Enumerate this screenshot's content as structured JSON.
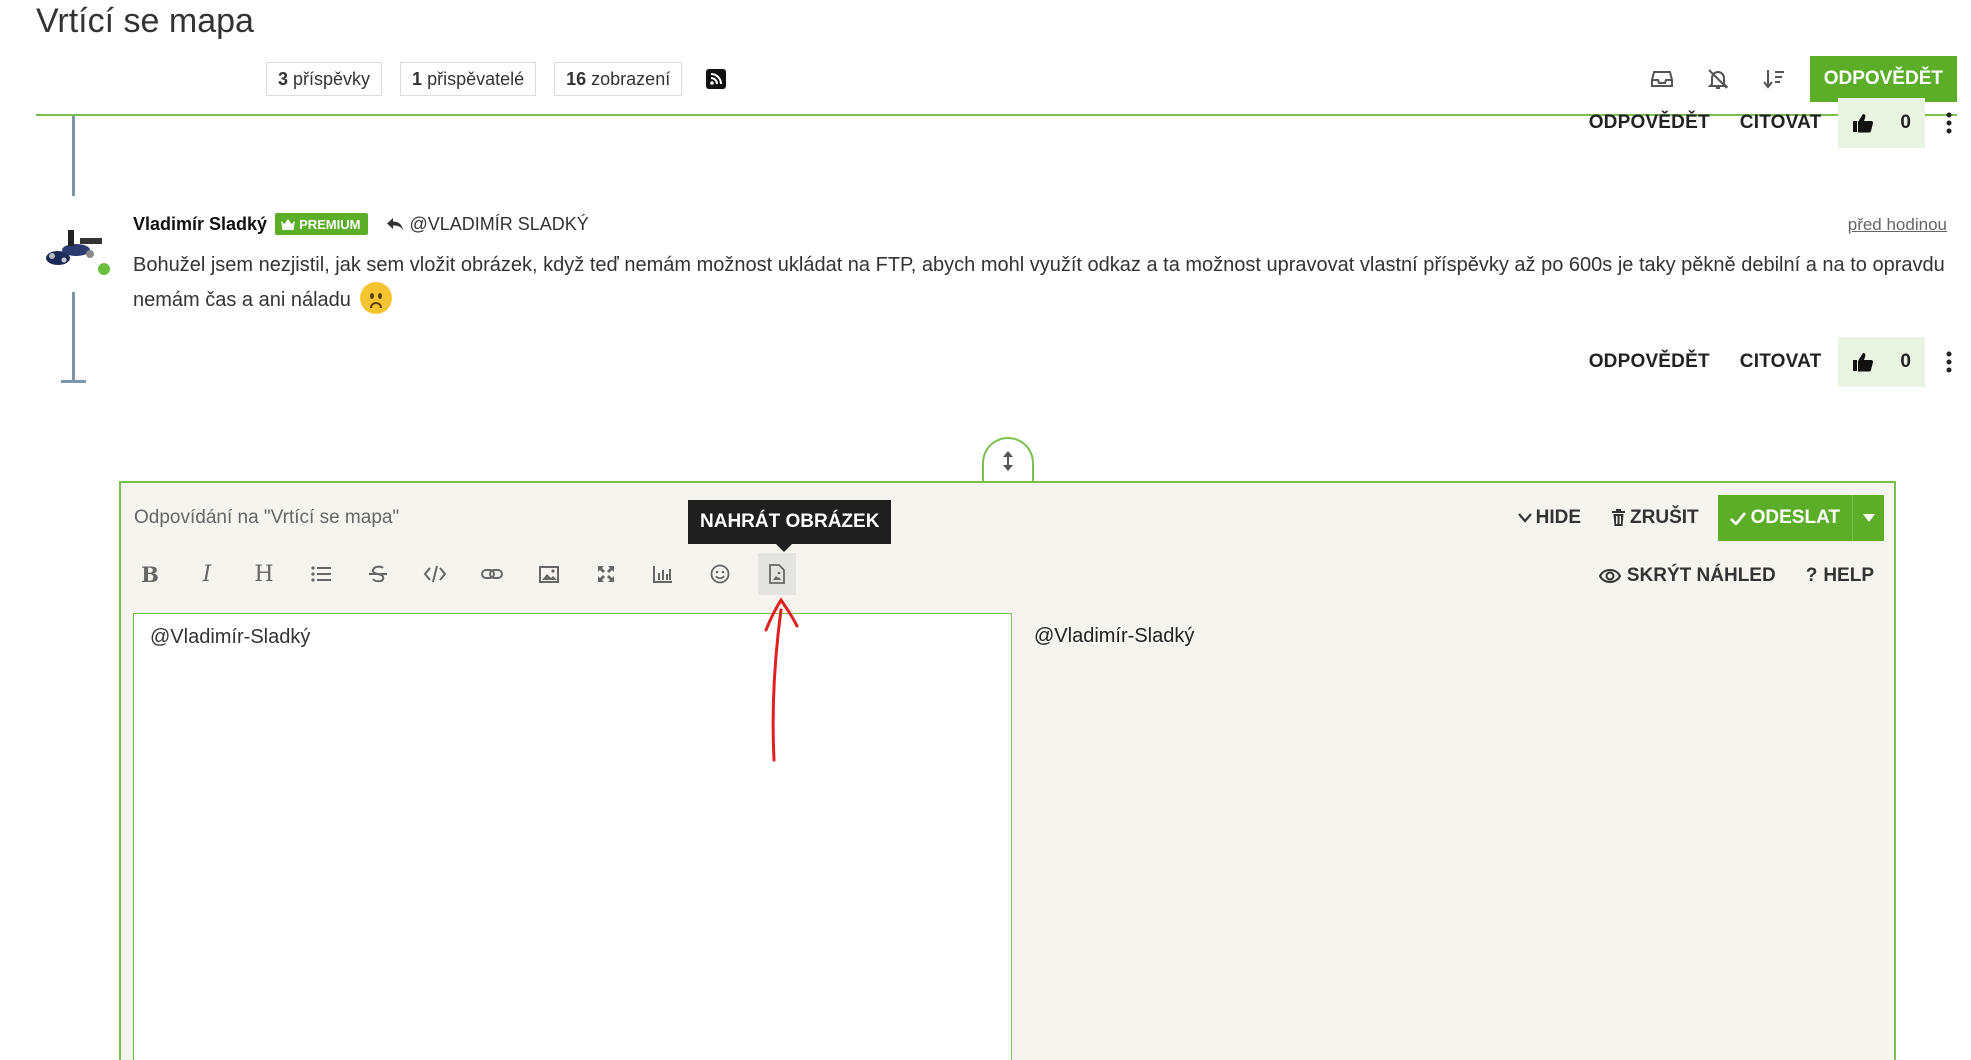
{
  "topic": {
    "title": "Vrtící se mapa"
  },
  "stats": [
    {
      "count": "3",
      "label": "příspěvky"
    },
    {
      "count": "1",
      "label": "přispěvatelé"
    },
    {
      "count": "16",
      "label": "zobrazení"
    }
  ],
  "header": {
    "reply_label": "ODPOVĚDĚT",
    "icons": [
      "inbox-icon",
      "bell-slash-icon",
      "sort-icon",
      "rss-icon"
    ]
  },
  "previous_post": {
    "reply_label": "ODPOVĚDĚT",
    "quote_label": "CITOVAT",
    "votes": "0"
  },
  "post": {
    "author": "Vladimír Sladký",
    "badge": "PREMIUM",
    "reply_to": "@VLADIMÍR SLADKÝ",
    "time": "před hodinou",
    "body": "Bohužel jsem nezjistil, jak sem vložit obrázek, když teď nemám možnost ukládat na FTP, abych mohl využít odkaz a ta možnost upravovat vlastní příspěvky až po 600s je taky pěkně debilní a na to opravdu nemám čas a ani náladu",
    "reply_label": "ODPOVĚDĚT",
    "quote_label": "CITOVAT",
    "votes": "0"
  },
  "composer": {
    "title": "Odpovídání na \"Vrtící se mapa\"",
    "hide_label": "HIDE",
    "cancel_label": "ZRUŠIT",
    "send_label": "ODESLAT",
    "tooltip": "NAHRÁT OBRÁZEK",
    "hide_preview_label": "SKRÝT NÁHLED",
    "help_label": "HELP",
    "editor_value": "@Vladimír-Sladký",
    "preview_text": "@Vladimír-Sladký",
    "toolbar_icons": [
      "bold-icon",
      "italic-icon",
      "heading-icon",
      "list-icon",
      "strikethrough-icon",
      "code-icon",
      "link-icon",
      "image-icon",
      "fullscreen-icon",
      "chart-icon",
      "emoji-icon",
      "upload-image-icon"
    ]
  },
  "colors": {
    "accent": "#5cae29",
    "timeline": "#7a96ad",
    "composer_bg": "#f5f4ef",
    "annotation": "#e02020"
  }
}
